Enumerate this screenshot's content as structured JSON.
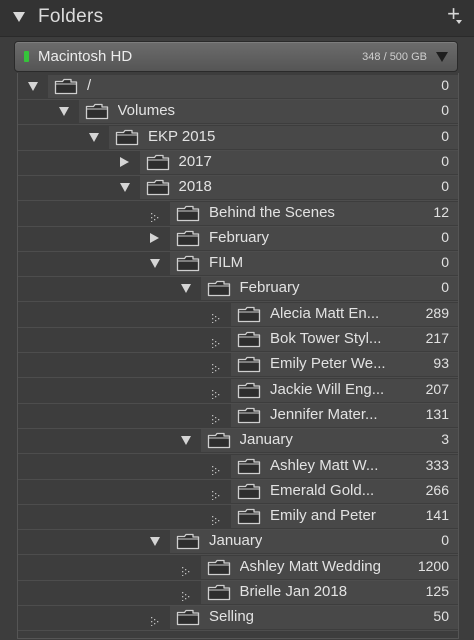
{
  "panel": {
    "title": "Folders",
    "add_label": "+"
  },
  "volume": {
    "name": "Macintosh HD",
    "usage": "348 / 500 GB",
    "status_color": "#35c43a"
  },
  "rows": [
    {
      "label": "/",
      "count": "0",
      "state": "expanded",
      "level": 0
    },
    {
      "label": "Volumes",
      "count": "0",
      "state": "expanded",
      "level": 1
    },
    {
      "label": "EKP 2015",
      "count": "0",
      "state": "expanded",
      "level": 2
    },
    {
      "label": "2017",
      "count": "0",
      "state": "collapsed",
      "level": 3
    },
    {
      "label": "2018",
      "count": "0",
      "state": "expanded",
      "level": 3
    },
    {
      "label": "Behind the Scenes",
      "count": "12",
      "state": "empty",
      "level": 4
    },
    {
      "label": "February",
      "count": "0",
      "state": "collapsed",
      "level": 4
    },
    {
      "label": "FILM",
      "count": "0",
      "state": "expanded",
      "level": 4
    },
    {
      "label": "February",
      "count": "0",
      "state": "expanded",
      "level": 5
    },
    {
      "label": "Alecia Matt En...",
      "count": "289",
      "state": "empty",
      "level": 6
    },
    {
      "label": "Bok Tower Styl...",
      "count": "217",
      "state": "empty",
      "level": 6
    },
    {
      "label": "Emily Peter We...",
      "count": "93",
      "state": "empty",
      "level": 6
    },
    {
      "label": "Jackie Will Eng...",
      "count": "207",
      "state": "empty",
      "level": 6
    },
    {
      "label": "Jennifer Mater...",
      "count": "131",
      "state": "empty",
      "level": 6
    },
    {
      "label": "January",
      "count": "3",
      "state": "expanded",
      "level": 5
    },
    {
      "label": "Ashley Matt W...",
      "count": "333",
      "state": "empty",
      "level": 6
    },
    {
      "label": "Emerald Gold...",
      "count": "266",
      "state": "empty",
      "level": 6
    },
    {
      "label": "Emily and Peter",
      "count": "141",
      "state": "empty",
      "level": 6
    },
    {
      "label": "January",
      "count": "0",
      "state": "expanded",
      "level": 4
    },
    {
      "label": "Ashley Matt Wedding",
      "count": "1200",
      "state": "empty",
      "level": 5
    },
    {
      "label": "Brielle Jan 2018",
      "count": "125",
      "state": "empty",
      "level": 5
    },
    {
      "label": "Selling",
      "count": "50",
      "state": "empty",
      "level": 4
    }
  ]
}
